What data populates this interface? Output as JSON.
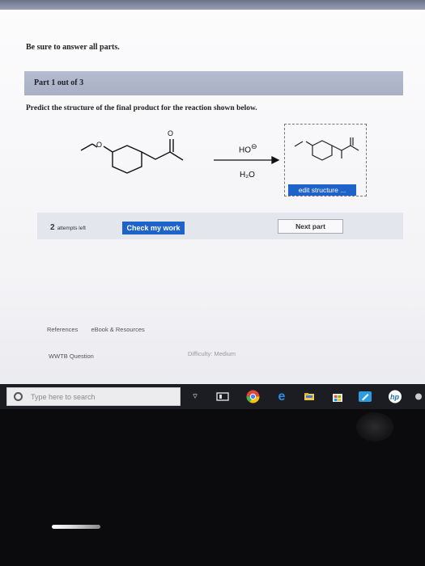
{
  "page": {
    "instructions": "Be sure to answer all parts."
  },
  "part": {
    "label": "Part 1 out of 3"
  },
  "question": {
    "prompt": "Predict the structure of the final product for the reaction shown below."
  },
  "reaction": {
    "reagent_top": "HO",
    "reagent_charge": "⊖",
    "reagent_bottom": "H₂O",
    "atom_label_o": "O",
    "edit_label": "edit structure ..."
  },
  "actions": {
    "attempts_count": "2",
    "attempts_text": "attempts left",
    "check_label": "Check my work",
    "next_label": "Next part"
  },
  "footer_links": {
    "references": "References",
    "ebook": "eBook & Resources",
    "wwtb": "WWTB Question",
    "difficulty": "Difficulty: Medium"
  },
  "taskbar": {
    "search_placeholder": "Type here to search"
  },
  "colors": {
    "accent_blue": "#1d63c9",
    "header_band": "#b1b7ca"
  }
}
